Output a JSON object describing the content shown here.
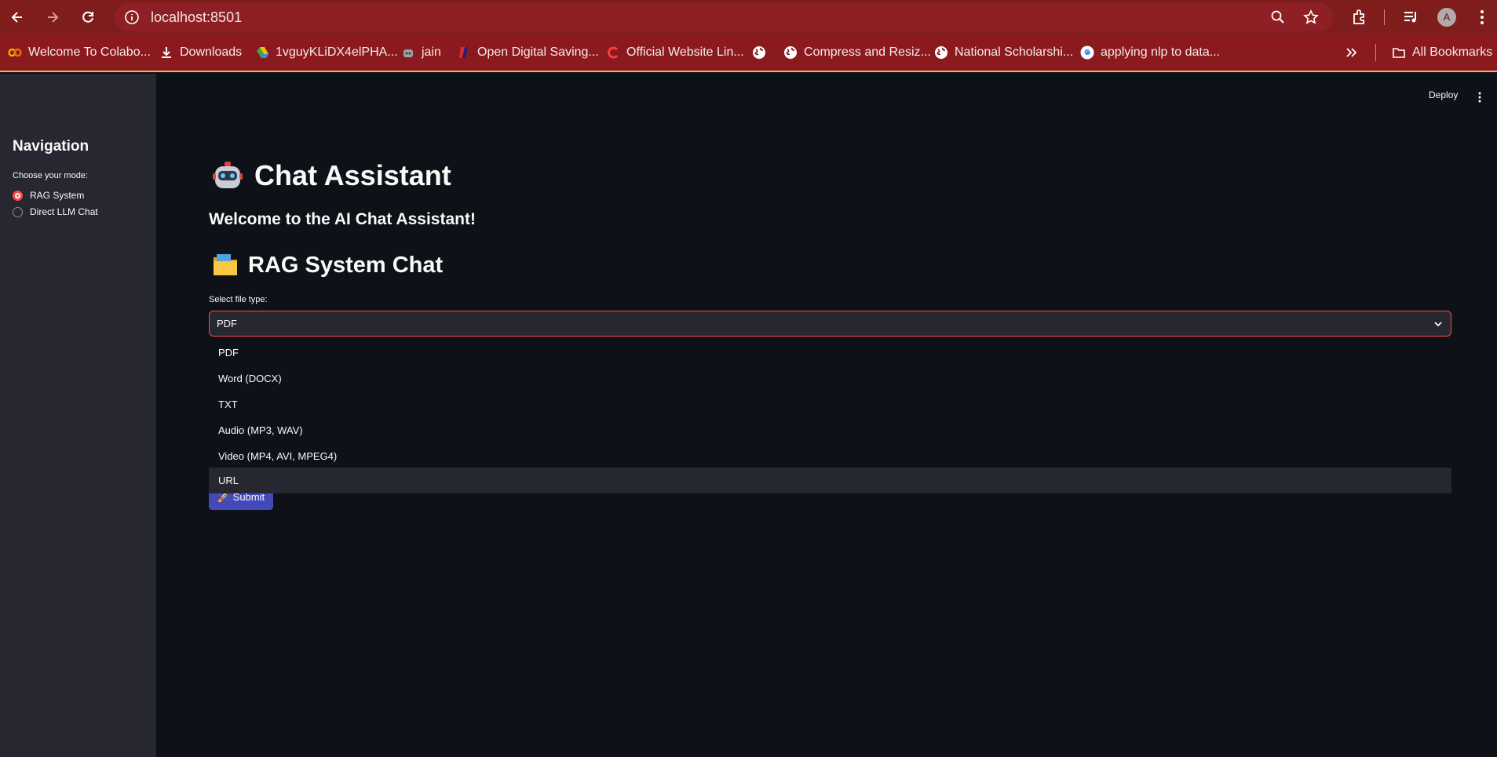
{
  "browser": {
    "url": "localhost:8501",
    "profile_initial": "A",
    "bookmarks": [
      {
        "label": "Welcome To Colabo...",
        "icon": "colab-icon"
      },
      {
        "label": "Downloads",
        "icon": "download-icon"
      },
      {
        "label": "1vguyKLiDX4elPHA...",
        "icon": "drive-icon"
      },
      {
        "label": "jain",
        "icon": "robot-icon"
      },
      {
        "label": "Open Digital Saving...",
        "icon": "bank-icon"
      },
      {
        "label": "Official Website Lin...",
        "icon": "brand-icon"
      },
      {
        "label": "",
        "icon": "globe-icon"
      },
      {
        "label": "Compress and Resiz...",
        "icon": "globe-icon"
      },
      {
        "label": "National Scholarshi...",
        "icon": "globe-icon"
      },
      {
        "label": "applying nlp to data...",
        "icon": "google-icon"
      }
    ],
    "all_bookmarks": "All Bookmarks"
  },
  "sidebar": {
    "title": "Navigation",
    "mode_label": "Choose your mode:",
    "options": [
      "RAG System",
      "Direct LLM Chat"
    ],
    "selected": "RAG System"
  },
  "header": {
    "deploy": "Deploy"
  },
  "main": {
    "title": "Chat Assistant",
    "welcome": "Welcome to the AI Chat Assistant!",
    "subheader": "RAG System Chat",
    "file_type_label": "Select file type:",
    "file_type_value": "PDF",
    "file_type_options": [
      "PDF",
      "Word (DOCX)",
      "TXT",
      "Audio (MP3, WAV)",
      "Video (MP4, AVI, MPEG4)",
      "URL"
    ],
    "highlighted_option": "URL",
    "submit": "🚀 Submit"
  },
  "colors": {
    "chrome": "#7f1d1d",
    "bookmarks_bar": "#8b1a1f",
    "sidebar": "#262730",
    "background": "#0e1117",
    "accent": "#ff4b4b",
    "submit": "#4349b8"
  }
}
